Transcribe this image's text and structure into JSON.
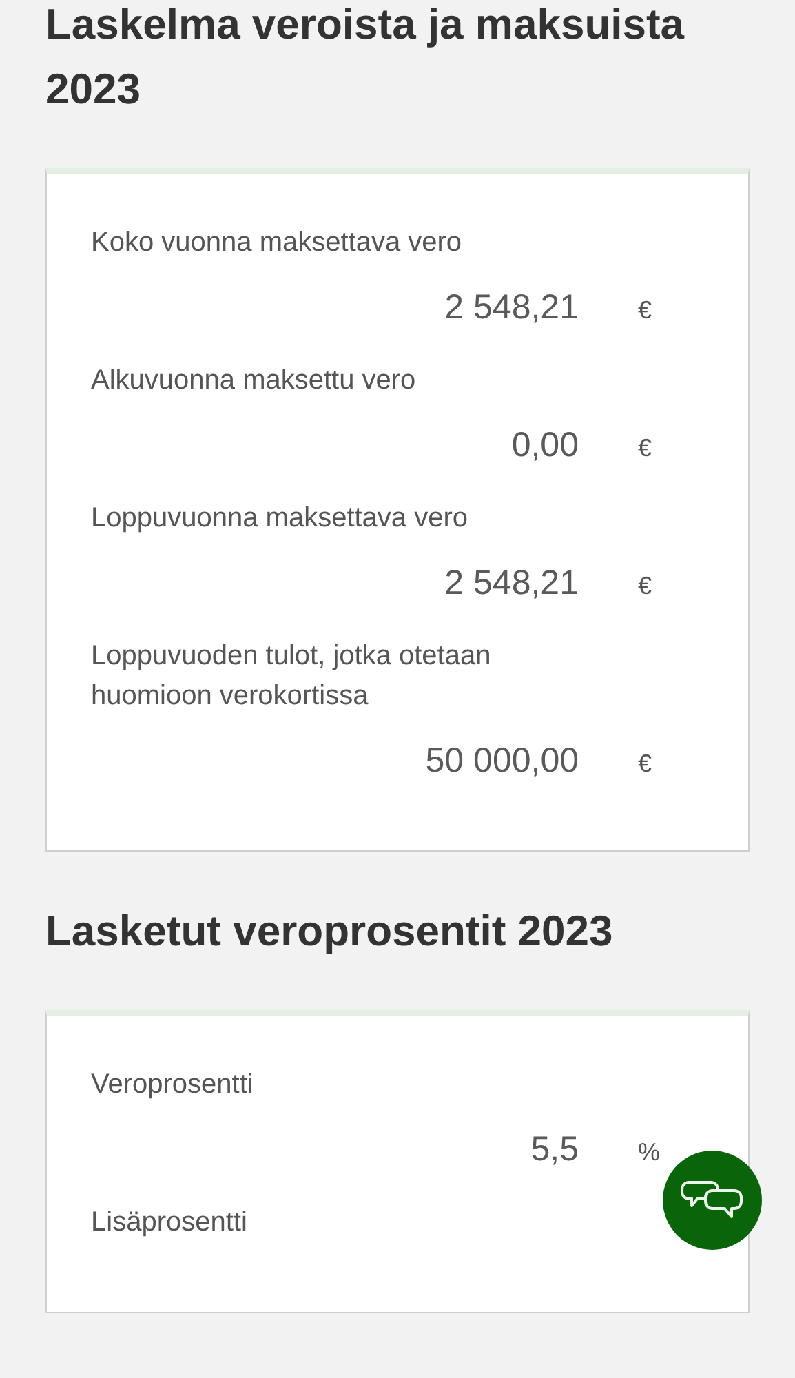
{
  "sections": [
    {
      "title": "Laskelma veroista ja maksuista 2023",
      "rows": [
        {
          "label": "Koko vuonna maksettava vero",
          "value": "2 548,21",
          "unit": "€"
        },
        {
          "label": "Alkuvuonna maksettu vero",
          "value": "0,00",
          "unit": "€"
        },
        {
          "label": "Loppuvuonna maksettava vero",
          "value": "2 548,21",
          "unit": "€"
        },
        {
          "label": "Loppuvuoden tulot, jotka otetaan huomioon verokortissa",
          "value": "50 000,00",
          "unit": "€"
        }
      ]
    },
    {
      "title": "Lasketut veroprosentit 2023",
      "rows": [
        {
          "label": "Veroprosentti",
          "value": "5,5",
          "unit": "%"
        },
        {
          "label": "Lisäprosentti"
        }
      ]
    }
  ],
  "chat_button": {
    "kind": "chat"
  }
}
